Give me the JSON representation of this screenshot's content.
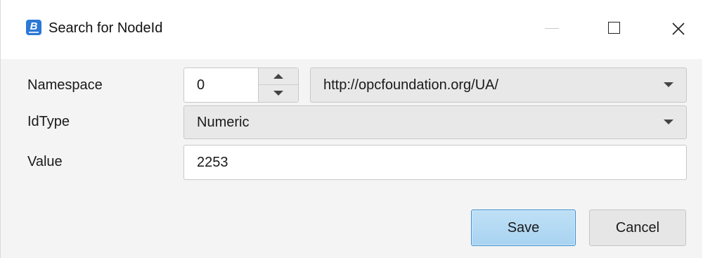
{
  "window": {
    "title": "Search for NodeId",
    "app_icon_letter": "B",
    "controls": [
      "minimize-icon",
      "maximize-icon",
      "close-icon"
    ]
  },
  "form": {
    "namespace": {
      "label": "Namespace",
      "index_value": "0",
      "uri_selected": "http://opcfoundation.org/UA/"
    },
    "id_type": {
      "label": "IdType",
      "selected": "Numeric"
    },
    "value": {
      "label": "Value",
      "text": "2253"
    }
  },
  "buttons": {
    "save_label": "Save",
    "cancel_label": "Cancel"
  },
  "colors": {
    "accent_border": "#3f8fd0",
    "save_fill": "#bfe0f6",
    "app_icon": "#2b78d6",
    "dialog_background": "#f4f4f4"
  }
}
